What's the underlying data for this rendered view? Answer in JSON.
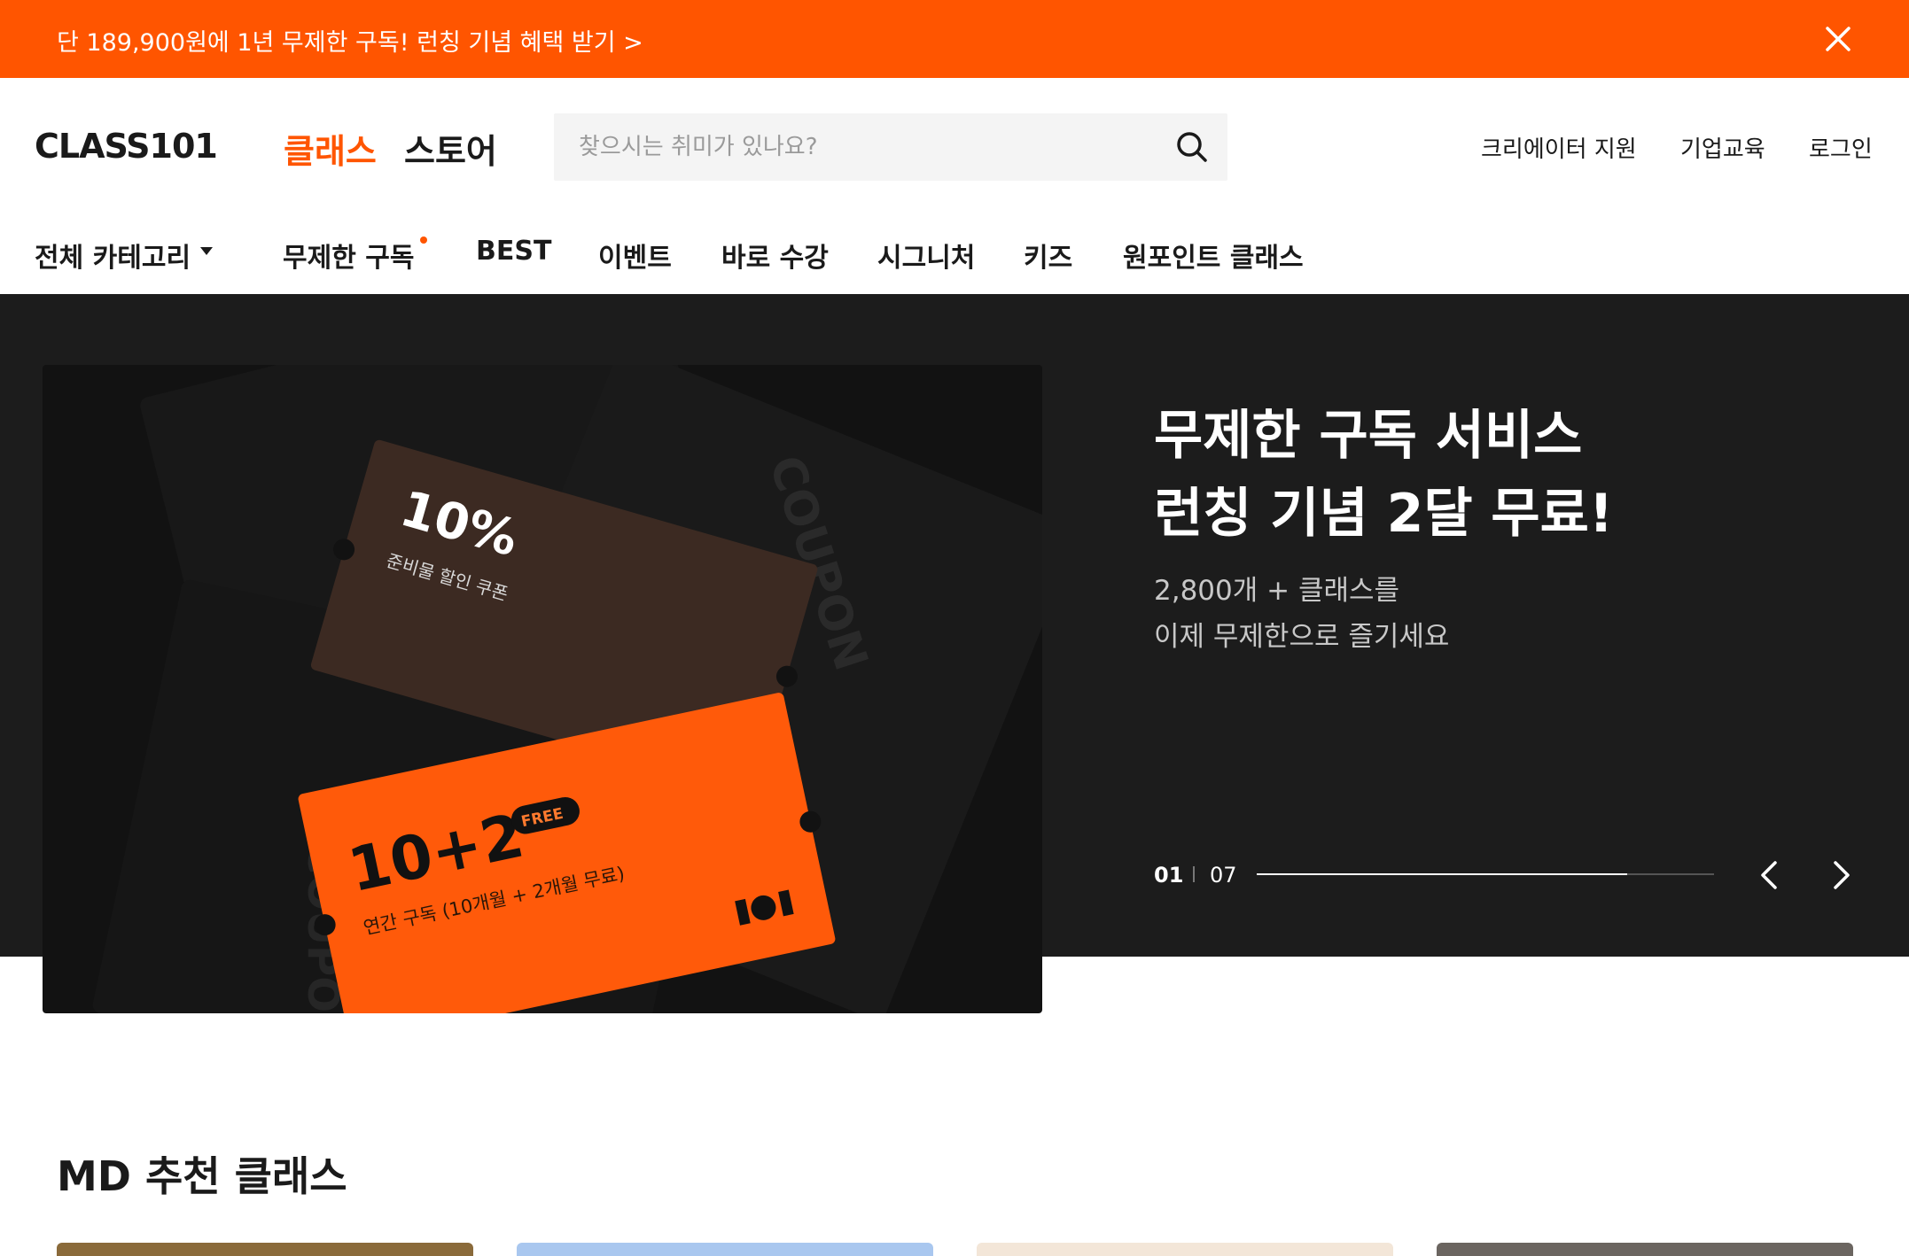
{
  "promo": {
    "text": "단 189,900원에 1년 무제한 구독! 런칭 기념 혜택 받기 >",
    "background": "#ff5500"
  },
  "header": {
    "logo": "CLASS101",
    "tabs": [
      {
        "label": "클래스",
        "active": true
      },
      {
        "label": "스토어",
        "active": false
      }
    ],
    "search": {
      "placeholder": "찾으시는 취미가 있나요?",
      "value": ""
    },
    "links": [
      "크리에이터 지원",
      "기업교육",
      "로그인"
    ]
  },
  "category_nav": {
    "items": [
      "전체 카테고리",
      "무제한 구독",
      "BEST",
      "이벤트",
      "바로 수강",
      "시그니처",
      "키즈",
      "원포인트 클래스"
    ],
    "has_new_dot": "무제한 구독"
  },
  "hero": {
    "title_line1": "무제한 구독 서비스",
    "title_line2": "런칭 기념 2달 무료!",
    "sub_line1": "2,800개 + 클래스를",
    "sub_line2": "이제 무제한으로 즐기세요",
    "current_slide": "01",
    "total_slides": "07",
    "progress": 0.81,
    "image": {
      "back_coupon_big": "10%",
      "back_coupon_small": "준비물 할인 쿠폰",
      "front_coupon_big": "10+2",
      "front_coupon_badge": "FREE",
      "front_coupon_small": "연간 구독 (10개월 + 2개월 무료)",
      "stamp_text": "COUPON"
    },
    "colors": {
      "background": "#1c1c1c",
      "accent": "#ff5500"
    }
  },
  "md_section": {
    "title": "MD 추천 클래스",
    "card_colors": [
      "#8a6a3a",
      "#a9c7ef",
      "#f3e6d8",
      "#6b6560"
    ]
  },
  "icons": {
    "close": "close-icon",
    "search": "search-icon",
    "caret": "caret-down-icon",
    "prev": "chevron-left-icon",
    "next": "chevron-right-icon"
  }
}
